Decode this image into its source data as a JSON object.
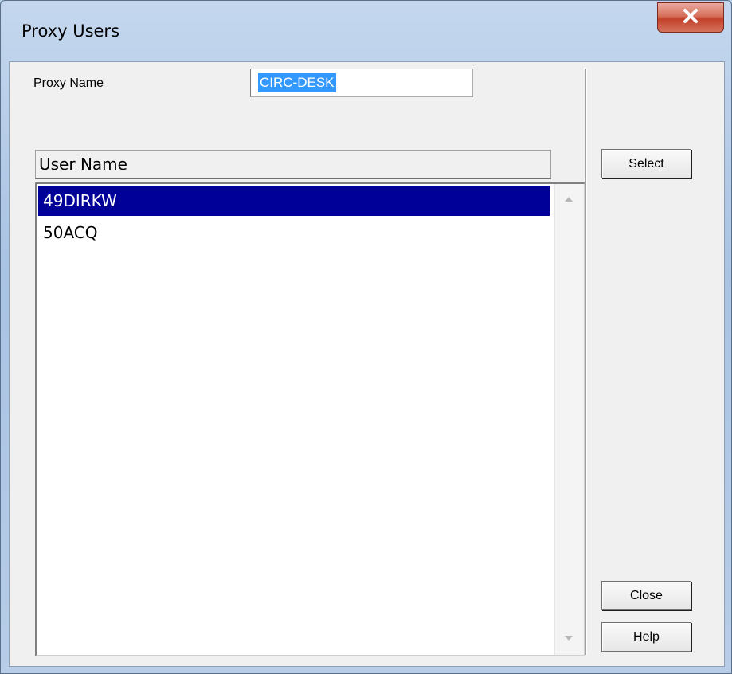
{
  "window": {
    "title": "Proxy Users"
  },
  "form": {
    "proxy_name_label": "Proxy Name",
    "proxy_name_value": "CIRC-DESK"
  },
  "list": {
    "column_header": "User Name",
    "rows": [
      "49DIRKW",
      "50ACQ"
    ],
    "selected_index": 0
  },
  "buttons": {
    "select": "Select",
    "close": "Close",
    "help": "Help"
  },
  "icons": {
    "window_close": "close-x-icon"
  },
  "colors": {
    "selection_bg": "#000099",
    "text_selection_bg": "#3399ff",
    "close_button": "#c2412a"
  }
}
